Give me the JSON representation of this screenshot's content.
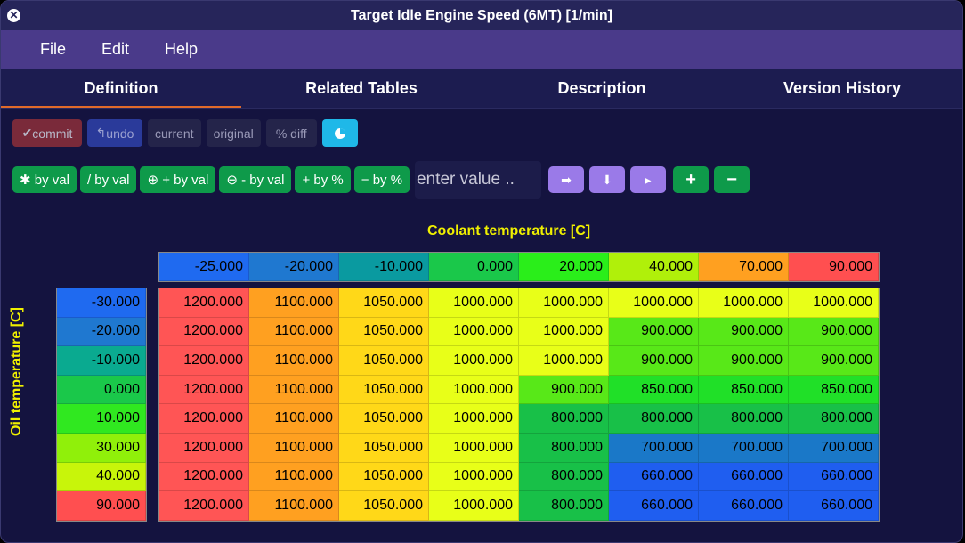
{
  "window": {
    "title": "Target Idle Engine Speed (6MT) [1/min]"
  },
  "menu": [
    "File",
    "Edit",
    "Help"
  ],
  "tabs": [
    "Definition",
    "Related Tables",
    "Description",
    "Version History"
  ],
  "toolbar1": {
    "commit": "commit",
    "undo": "undo",
    "current": "current",
    "original": "original",
    "diff": "% diff"
  },
  "toolbar2": {
    "mul_val": "by val",
    "div_val": "/ by val",
    "add_val": "+ by val",
    "sub_val": "- by val",
    "add_pct": "by %",
    "sub_pct": "by %",
    "input_placeholder": "enter value .."
  },
  "axes": {
    "x_label": "Coolant temperature [C]",
    "y_label": "Oil temperature [C]"
  },
  "x_values": [
    "-25.000",
    "-20.000",
    "-10.000",
    "0.000",
    "20.000",
    "40.000",
    "70.000",
    "90.000"
  ],
  "y_values": [
    "-30.000",
    "-20.000",
    "-10.000",
    "0.000",
    "10.000",
    "30.000",
    "40.000",
    "90.000"
  ],
  "table": [
    [
      "1200.000",
      "1100.000",
      "1050.000",
      "1000.000",
      "1000.000",
      "1000.000",
      "1000.000",
      "1000.000"
    ],
    [
      "1200.000",
      "1100.000",
      "1050.000",
      "1000.000",
      "1000.000",
      "900.000",
      "900.000",
      "900.000"
    ],
    [
      "1200.000",
      "1100.000",
      "1050.000",
      "1000.000",
      "1000.000",
      "900.000",
      "900.000",
      "900.000"
    ],
    [
      "1200.000",
      "1100.000",
      "1050.000",
      "1000.000",
      "900.000",
      "850.000",
      "850.000",
      "850.000"
    ],
    [
      "1200.000",
      "1100.000",
      "1050.000",
      "1000.000",
      "800.000",
      "800.000",
      "800.000",
      "800.000"
    ],
    [
      "1200.000",
      "1100.000",
      "1050.000",
      "1000.000",
      "800.000",
      "700.000",
      "700.000",
      "700.000"
    ],
    [
      "1200.000",
      "1100.000",
      "1050.000",
      "1000.000",
      "800.000",
      "660.000",
      "660.000",
      "660.000"
    ],
    [
      "1200.000",
      "1100.000",
      "1050.000",
      "1000.000",
      "800.000",
      "660.000",
      "660.000",
      "660.000"
    ]
  ],
  "colors": {
    "x_header": [
      "#1f6af0",
      "#1f78d0",
      "#0a9aa0",
      "#1ac84a",
      "#2aee1a",
      "#b0f00a",
      "#ffa020",
      "#ff4f50"
    ],
    "y_header": [
      "#1f6af0",
      "#1f78d0",
      "#0aaa90",
      "#1ac84a",
      "#30e820",
      "#90f00a",
      "#c8f50a",
      "#ff4f50"
    ],
    "value_map": {
      "1200.000": "#ff5555",
      "1100.000": "#ffa020",
      "1050.000": "#ffd818",
      "1000.000": "#e8ff18",
      "900.000": "#58e818",
      "850.000": "#20e028",
      "800.000": "#18c048",
      "700.000": "#1a78c8",
      "660.000": "#1f5ef0"
    }
  }
}
